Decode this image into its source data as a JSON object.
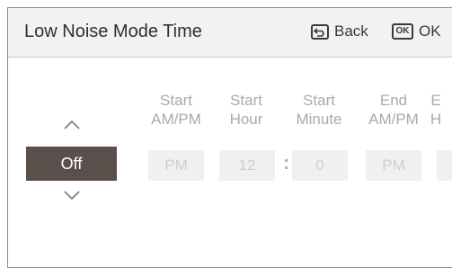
{
  "header": {
    "title": "Low Noise Mode Time",
    "back_label": "Back",
    "ok_label": "OK",
    "ok_icon_text": "OK"
  },
  "mode": {
    "value": "Off"
  },
  "columns": [
    {
      "line1": "Start",
      "line2": "AM/PM",
      "value": "PM"
    },
    {
      "line1": "Start",
      "line2": "Hour",
      "value": "12"
    },
    {
      "line1": "Start",
      "line2": "Minute",
      "value": "0"
    },
    {
      "line1": "End",
      "line2": "AM/PM",
      "value": "PM"
    },
    {
      "line1": "E",
      "line2": "H",
      "value": ""
    }
  ],
  "separator": ":",
  "colors": {
    "header_bg": "#f2f2f0",
    "mode_bg": "#5b4f4c",
    "field_bg": "#f0f0f0",
    "label_text": "#aaaaaa"
  }
}
